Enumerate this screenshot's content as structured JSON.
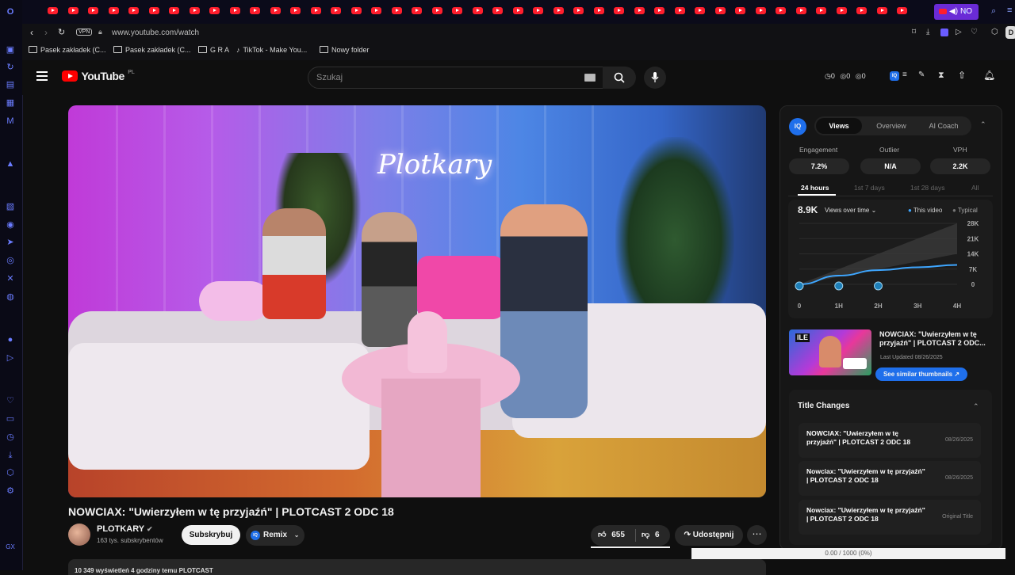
{
  "browser": {
    "url": "www.youtube.com/watch",
    "vpn_label": "VPN",
    "active_tab_label": "NO",
    "bookmarks": [
      "Pasek zakładek (C...",
      "Pasek zakładek (C...",
      "G R A",
      "TikTok - Make You...",
      "Nowy folder"
    ],
    "profile_initial": "D"
  },
  "youtube": {
    "logo": "YouTube",
    "region": "PL",
    "search_placeholder": "Szukaj",
    "header_counters": [
      "0",
      "0",
      "0"
    ]
  },
  "video": {
    "neon_sign": "Plotkary",
    "title": "NOWCIAX: \"Uwierzyłem w tę przyjaźń\" | PLOTCAST 2 ODC 18",
    "channel_name": "PLOTKARY",
    "subscribers": "163 tys. subskrybentów",
    "subscribe_label": "Subskrybuj",
    "remix_label": "Remix",
    "likes": "655",
    "dislikes": "6",
    "share_label": "Udostępnij",
    "meta_partial": "10 349 wyświetleń  4 godziny temu  PLOTCAST"
  },
  "vidiq": {
    "badge": "IQ",
    "tabs": [
      "Views",
      "Overview",
      "AI Coach"
    ],
    "active_tab": "Views",
    "stats": [
      {
        "label": "Engagement",
        "value": "7.2%"
      },
      {
        "label": "Outlier",
        "value": "N/A"
      },
      {
        "label": "VPH",
        "value": "2.2K"
      }
    ],
    "ranges": [
      "24 hours",
      "1st 7 days",
      "1st 28 days",
      "All"
    ],
    "active_range": "24 hours",
    "views_total": "8.9K",
    "views_dropdown": "Views over time",
    "legend": [
      "This video",
      "Typical"
    ],
    "colors": {
      "this_video": "#3ea6ff",
      "typical": "#555555",
      "accent": "#1f6feb"
    },
    "thumb_title": "NOWCIAX: \"Uwierzyłem w tę przyjaźń\" | PLOTCAST 2 ODC...",
    "last_updated": "Last Updated 08/26/2025",
    "similar_btn": "See similar thumbnails",
    "title_changes_header": "Title Changes",
    "title_changes": [
      {
        "title": "NOWCIAX: \"Uwierzyłem w tę przyjaźń\" | PLOTCAST 2 ODC 18",
        "date": "08/26/2025"
      },
      {
        "title": "Nowciax: \"Uwierzyłem w tę przyjaźń\" | PLOTCAST 2 ODC 18",
        "date": "08/26/2025"
      },
      {
        "title": "Nowciax: \"Uwierzyłem w tę przyjaźń\" | PLOTCAST 2 ODC 18",
        "date": "Original Title"
      }
    ]
  },
  "chart_data": {
    "type": "line",
    "x": [
      "0",
      "1H",
      "2H",
      "3H",
      "4H"
    ],
    "y_ticks": [
      "28K",
      "21K",
      "14K",
      "7K",
      "0"
    ],
    "ylim": [
      0,
      28000
    ],
    "series": [
      {
        "name": "This video",
        "values": [
          0,
          4000,
          6500,
          7800,
          8900
        ]
      }
    ],
    "typical_band": {
      "low": [
        0,
        3500,
        7000,
        10500,
        14000
      ],
      "high": [
        0,
        7000,
        14000,
        21000,
        28000
      ]
    },
    "markers_at": [
      "0",
      "1H",
      "2H"
    ],
    "grid": true,
    "legend": "top-right"
  },
  "overlay": {
    "progress_text": "0.00 / 1000 (0%)"
  }
}
